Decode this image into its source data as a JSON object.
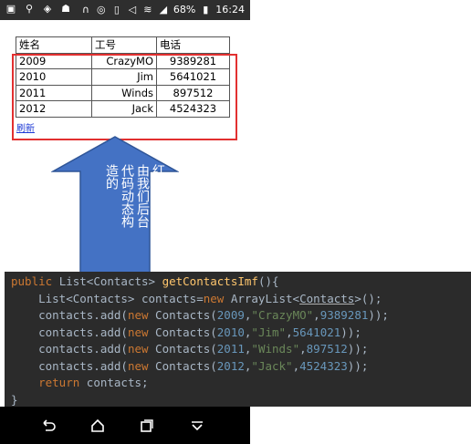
{
  "status_bar": {
    "battery_pct": "68%",
    "time": "16:24",
    "left_icons": [
      "notification-icon",
      "usb-icon",
      "shield-icon",
      "android-icon"
    ],
    "right_icons": [
      "headset-icon",
      "sync-icon",
      "vibrate-icon",
      "mute-icon",
      "wifi-icon",
      "signal-icon",
      "battery-icon"
    ]
  },
  "table": {
    "headers": [
      "姓名",
      "工号",
      "电话"
    ],
    "rows": [
      [
        "2009",
        "CrazyMO",
        "9389281"
      ],
      [
        "2010",
        "Jim",
        "5641021"
      ],
      [
        "2011",
        "Winds",
        "897512"
      ],
      [
        "2012",
        "Jack",
        "4524323"
      ]
    ]
  },
  "link_text": "刷新",
  "annotation_text": "红色部分是由我们后台代码动态构造的",
  "annotation_lines": [
    "红色部分是",
    "由我们后台",
    "代码动态构",
    "造的"
  ],
  "code": {
    "line1": {
      "kw1": "public ",
      "t1": "List<Contacts> ",
      "fn": "getContactsImf",
      "t2": "(){"
    },
    "line2": {
      "t1": "    List<Contacts> contacts=",
      "kw": "new ",
      "t2": "ArrayList<",
      "ul": "Contacts",
      "t3": ">();"
    },
    "rows": [
      {
        "t1": "    contacts.add(",
        "kw": "new ",
        "t2": "Contacts(",
        "n1": "2009",
        "c1": ",",
        "s": "\"CrazyMO\"",
        "c2": ",",
        "n2": "9389281",
        "t3": "));"
      },
      {
        "t1": "    contacts.add(",
        "kw": "new ",
        "t2": "Contacts(",
        "n1": "2010",
        "c1": ",",
        "s": "\"Jim\"",
        "c2": ",",
        "n2": "5641021",
        "t3": "));"
      },
      {
        "t1": "    contacts.add(",
        "kw": "new ",
        "t2": "Contacts(",
        "n1": "2011",
        "c1": ",",
        "s": "\"Winds\"",
        "c2": ",",
        "n2": "897512",
        "t3": "));"
      },
      {
        "t1": "    contacts.add(",
        "kw": "new ",
        "t2": "Contacts(",
        "n1": "2012",
        "c1": ",",
        "s": "\"Jack\"",
        "c2": ",",
        "n2": "4524323",
        "t3": "));"
      }
    ],
    "ret": {
      "kw": "    return ",
      "t": "contacts;"
    },
    "close": "}"
  },
  "nav_bar": [
    "back-icon",
    "home-icon",
    "recents-icon",
    "dropdown-icon"
  ],
  "colors": {
    "arrow_fill": "#4472c4",
    "highlight_border": "#e23030",
    "code_bg": "#2b2b2b",
    "keyword": "#cc7832",
    "string": "#6a8759",
    "number": "#6897bb",
    "function": "#ffc66d"
  }
}
